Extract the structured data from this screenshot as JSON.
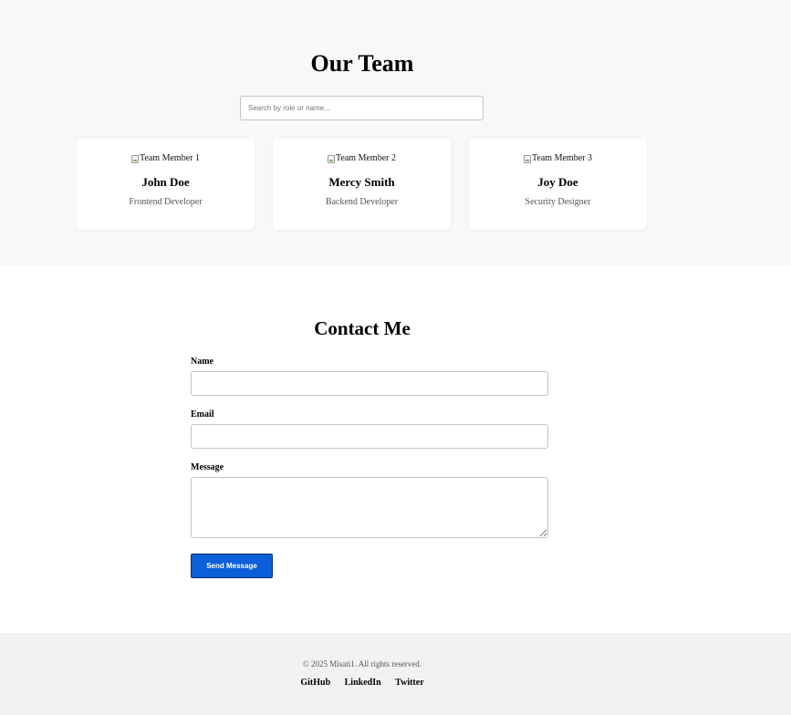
{
  "team": {
    "title": "Our Team",
    "search_placeholder": "Search by role or name...",
    "members": [
      {
        "photo_alt": "Team Member 1",
        "name": "John Doe",
        "role": "Frontend Developer"
      },
      {
        "photo_alt": "Team Member 2",
        "name": "Mercy Smith",
        "role": "Backend Developer"
      },
      {
        "photo_alt": "Team Member 3",
        "name": "Joy Doe",
        "role": "Security Designer"
      }
    ]
  },
  "contact": {
    "title": "Contact Me",
    "name_label": "Name",
    "name_value": "",
    "email_label": "Email",
    "email_value": "",
    "message_label": "Message",
    "message_value": "",
    "submit_label": "Send Message",
    "submit_color": "#0b5fd8"
  },
  "footer": {
    "copyright": "© 2025 Misati1. All rights reserved.",
    "links": [
      "GitHub",
      "LinkedIn",
      "Twitter"
    ]
  },
  "icons": {
    "broken_image": "broken-image-icon",
    "textarea_resize": "resize-handle-icon"
  }
}
